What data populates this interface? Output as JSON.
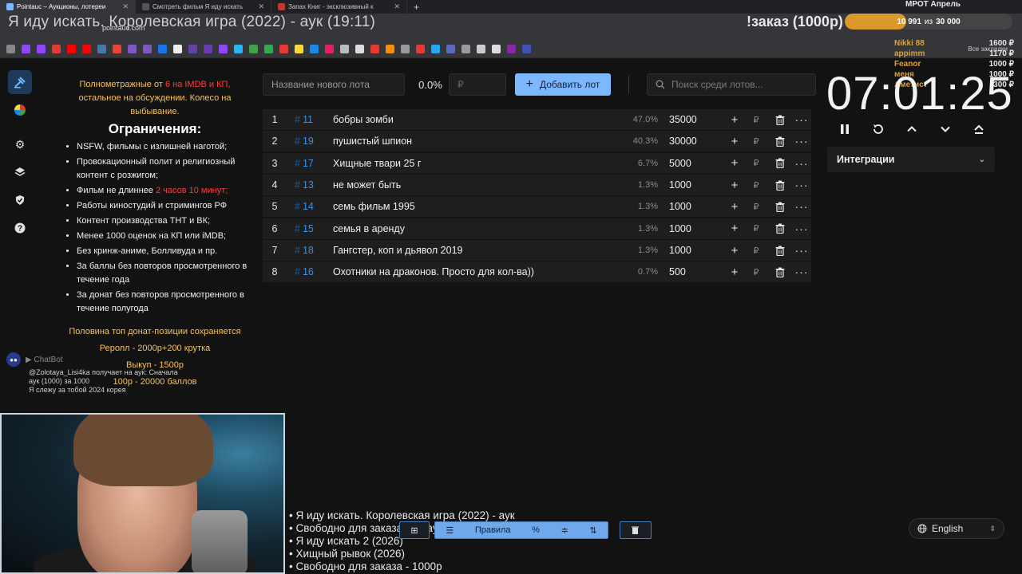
{
  "browser": {
    "tabs": [
      {
        "title": "Pointauc – Аукционы, лотереи",
        "active": true
      },
      {
        "title": "Смотреть фильм Я иду искать",
        "active": false
      },
      {
        "title": "Запах Книг - эксклюзивный к",
        "active": false
      }
    ],
    "url": "pointauc.com",
    "bookmarks_all": "Все закладки"
  },
  "overlay": {
    "stream_title": "Я иду искать. Королевская игра (2022) - аук (19:11)",
    "order_label": "!заказ (1000р)",
    "goal_title": "МРОТ Апрель",
    "goal_current": "10 991",
    "goal_sep": "из",
    "goal_target": "30 000",
    "goal_progress": 0.366,
    "donors": [
      {
        "name": "Nikki 88",
        "amount": "1600 ₽"
      },
      {
        "name": "appimm",
        "amount": "1170 ₽"
      },
      {
        "name": "Feanor",
        "amount": "1000 ₽"
      },
      {
        "name": "меня",
        "amount": "1000 ₽"
      },
      {
        "name": "Аметист",
        "amount": "300 ₽"
      }
    ]
  },
  "rules": {
    "intro_a": "Полнометражные от",
    "intro_red": "6 на IMDB и КП,",
    "intro_b": "остальное на обсуждении. Колесо на выбывание.",
    "heading": "Ограничения:",
    "items": [
      "NSFW, фильмы с излишней наготой;",
      "Провокационный полит и религиозный контент с розжигом;",
      "Фильм не длиннее",
      "Работы киностудий и стримингов РФ",
      "Контент производства ТНТ и ВК;",
      "Менее 1000 оценок на КП или iMDB;",
      "Без кринж-аниме, Болливуда и пр.",
      "За баллы без повторов просмотренного в течение года",
      "За донат без повторов просмотренного в течение полугода"
    ],
    "length_red": "2 часов 10 минут;",
    "note1": "Половина топ донат-позиции сохраняется",
    "note2": "Реролл - 2000р+200 крутка",
    "note3": "Выкуп - 1500р",
    "note4": "100р - 20000 баллов"
  },
  "chatbot": {
    "name": "ChatBot",
    "lines": [
      "@Zolotaya_Lisi4ka получает на аук: Сначала",
      "аук (1000) за 1000",
      "Я слежу за тобой 2024  корея"
    ]
  },
  "toolbar": {
    "lot_placeholder": "Название нового лота",
    "percent": "0.0%",
    "price_placeholder": "₽",
    "add_label": "Добавить лот",
    "search_placeholder": "Поиск среди лотов..."
  },
  "lots": [
    {
      "n": "1",
      "id": "11",
      "name": "бобры зомби",
      "pct": "47.0%",
      "amount": "35000"
    },
    {
      "n": "2",
      "id": "19",
      "name": "пушистый шпион",
      "pct": "40.3%",
      "amount": "30000"
    },
    {
      "n": "3",
      "id": "17",
      "name": "Хищные твари 25 г",
      "pct": "6.7%",
      "amount": "5000"
    },
    {
      "n": "4",
      "id": "13",
      "name": "не может быть",
      "pct": "1.3%",
      "amount": "1000"
    },
    {
      "n": "5",
      "id": "14",
      "name": "семь фильм 1995",
      "pct": "1.3%",
      "amount": "1000"
    },
    {
      "n": "6",
      "id": "15",
      "name": "семья в аренду",
      "pct": "1.3%",
      "amount": "1000"
    },
    {
      "n": "7",
      "id": "18",
      "name": "Гангстер, коп и дьявол 2019",
      "pct": "1.3%",
      "amount": "1000"
    },
    {
      "n": "8",
      "id": "16",
      "name": "Охотники на драконов.  Просто для кол-ва))",
      "pct": "0.7%",
      "amount": "500"
    }
  ],
  "timer": {
    "time": "07:01:25",
    "integrations_label": "Интеграции"
  },
  "ticker": [
    "• Я иду искать. Королевская игра (2022) - аук",
    "• Свободно для заказа или аук - 1000р",
    "• Я иду искать 2 (2026)",
    "• Хищный рывок (2026)",
    "• Свободно для заказа - 1000р"
  ],
  "bottom": {
    "rules_label": "Правила",
    "language": "English"
  }
}
